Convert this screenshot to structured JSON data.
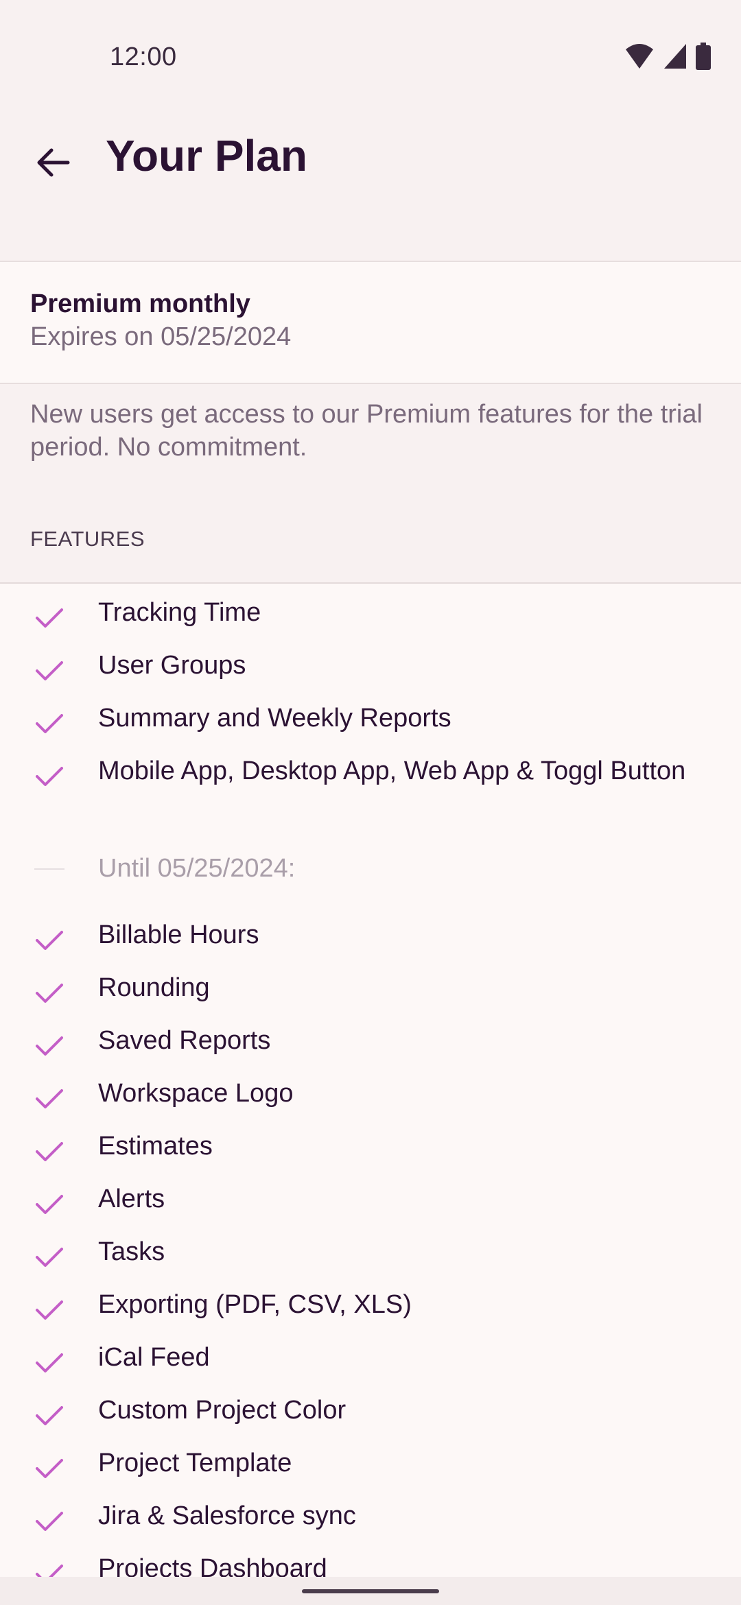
{
  "status_bar": {
    "time": "12:00",
    "icons": [
      "wifi-icon",
      "cellular-signal-icon",
      "battery-icon"
    ]
  },
  "app_bar": {
    "back_icon": "arrow-left-icon",
    "title": "Your Plan"
  },
  "plan": {
    "name": "Premium monthly",
    "expiry": "Expires on 05/25/2024"
  },
  "trial_note": "New users get access to our Premium features for the trial period. No commitment.",
  "features_header": "FEATURES",
  "features": {
    "included": [
      "Tracking Time",
      "User Groups",
      "Summary and Weekly Reports",
      "Mobile App, Desktop App, Web App & Toggl Button"
    ],
    "until_label": "Until 05/25/2024:",
    "trial": [
      "Billable Hours",
      "Rounding",
      "Saved Reports",
      "Workspace Logo",
      "Estimates",
      "Alerts",
      "Tasks",
      "Exporting (PDF, CSV, XLS)",
      "iCal Feed",
      "Custom Project Color",
      "Project Template",
      "Jira & Salesforce sync",
      "Projects Dashboard"
    ]
  },
  "colors": {
    "accent_check": "#c45ec7",
    "title_text": "#2b1233",
    "secondary_text": "#7a6a7c",
    "muted_text": "#a99ea9",
    "background": "#f8f1f1",
    "card_background": "#fdf8f7"
  }
}
